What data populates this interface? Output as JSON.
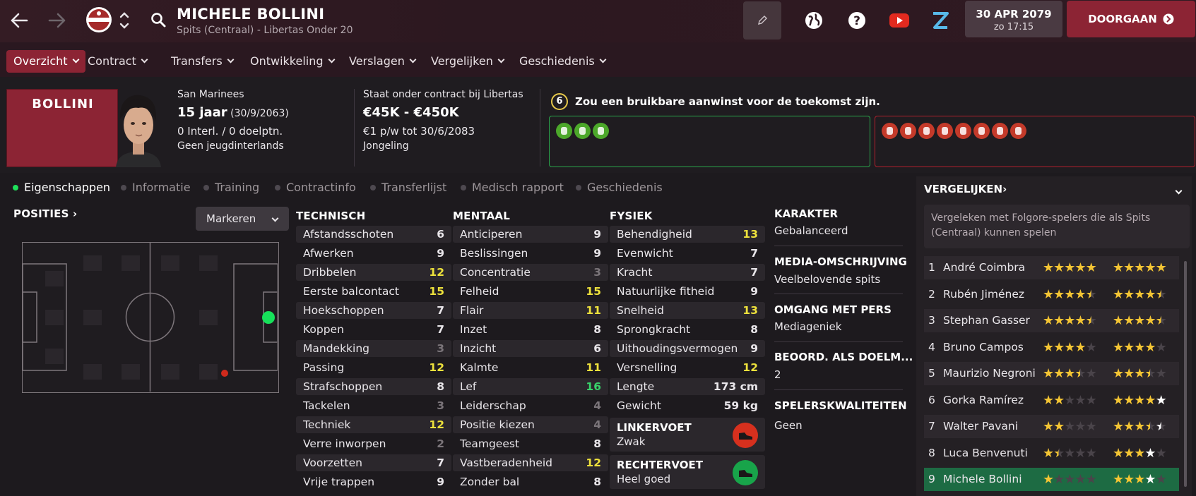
{
  "header": {
    "player_name": "MICHELE BOLLINI",
    "subtitle": "Spits (Centraal) - Libertas Onder 20",
    "date": "30 APR 2079",
    "time": "zo 17:15",
    "continue_label": "DOORGAAN"
  },
  "nav": {
    "items": [
      "Overzicht",
      "Contract",
      "Transfers",
      "Ontwikkeling",
      "Verslagen",
      "Vergelijken",
      "Geschiedenis"
    ]
  },
  "profile": {
    "card_name": "BOLLINI",
    "nationality": "San Marinees",
    "age": "15 jaar",
    "dob": "(30/9/2063)",
    "caps": "0 Interl. / 0 doelptn.",
    "youth_caps": "Geen jeugdinterlands",
    "contract_status": "Staat onder contract bij Libertas",
    "value": "€45K - €450K",
    "wage": "€1 p/w tot 30/6/2083",
    "contract_type": "Jongeling",
    "scout_rating": "6",
    "scout_text": "Zou een bruikbare aanwinst voor de toekomst zijn."
  },
  "tabs": [
    "Eigenschappen",
    "Informatie",
    "Training",
    "Contractinfo",
    "Transferlijst",
    "Medisch rapport",
    "Geschiedenis"
  ],
  "positions": {
    "title": "POSITIES",
    "mark_label": "Markeren"
  },
  "technical": {
    "title": "TECHNISCH",
    "rows": [
      {
        "label": "Afstandsschoten",
        "value": "6",
        "c": "w"
      },
      {
        "label": "Afwerken",
        "value": "9",
        "c": "w"
      },
      {
        "label": "Dribbelen",
        "value": "12",
        "c": "y"
      },
      {
        "label": "Eerste balcontact",
        "value": "15",
        "c": "y"
      },
      {
        "label": "Hoekschoppen",
        "value": "7",
        "c": "w"
      },
      {
        "label": "Koppen",
        "value": "7",
        "c": "w"
      },
      {
        "label": "Mandekking",
        "value": "3",
        "c": "gr"
      },
      {
        "label": "Passing",
        "value": "12",
        "c": "y"
      },
      {
        "label": "Strafschoppen",
        "value": "8",
        "c": "w"
      },
      {
        "label": "Tackelen",
        "value": "3",
        "c": "gr"
      },
      {
        "label": "Techniek",
        "value": "12",
        "c": "y"
      },
      {
        "label": "Verre inworpen",
        "value": "2",
        "c": "gr"
      },
      {
        "label": "Voorzetten",
        "value": "7",
        "c": "w"
      },
      {
        "label": "Vrije trappen",
        "value": "9",
        "c": "w"
      }
    ]
  },
  "mental": {
    "title": "MENTAAL",
    "rows": [
      {
        "label": "Anticiperen",
        "value": "9",
        "c": "w"
      },
      {
        "label": "Beslissingen",
        "value": "9",
        "c": "w"
      },
      {
        "label": "Concentratie",
        "value": "3",
        "c": "gr"
      },
      {
        "label": "Felheid",
        "value": "15",
        "c": "y"
      },
      {
        "label": "Flair",
        "value": "11",
        "c": "y"
      },
      {
        "label": "Inzet",
        "value": "8",
        "c": "w"
      },
      {
        "label": "Inzicht",
        "value": "6",
        "c": "w"
      },
      {
        "label": "Kalmte",
        "value": "11",
        "c": "y"
      },
      {
        "label": "Lef",
        "value": "16",
        "c": "g"
      },
      {
        "label": "Leiderschap",
        "value": "4",
        "c": "gr"
      },
      {
        "label": "Positie kiezen",
        "value": "4",
        "c": "gr"
      },
      {
        "label": "Teamgeest",
        "value": "8",
        "c": "w"
      },
      {
        "label": "Vastberadenheid",
        "value": "12",
        "c": "y"
      },
      {
        "label": "Zonder bal",
        "value": "8",
        "c": "w"
      }
    ]
  },
  "physical": {
    "title": "FYSIEK",
    "rows": [
      {
        "label": "Behendigheid",
        "value": "13",
        "c": "y"
      },
      {
        "label": "Evenwicht",
        "value": "7",
        "c": "w"
      },
      {
        "label": "Kracht",
        "value": "7",
        "c": "w"
      },
      {
        "label": "Natuurlijke fitheid",
        "value": "9",
        "c": "w"
      },
      {
        "label": "Snelheid",
        "value": "13",
        "c": "y"
      },
      {
        "label": "Sprongkracht",
        "value": "8",
        "c": "w"
      },
      {
        "label": "Uithoudingsvermogen",
        "value": "9",
        "c": "w"
      },
      {
        "label": "Versnelling",
        "value": "12",
        "c": "y"
      },
      {
        "label": "Lengte",
        "value": "173 cm",
        "c": "w"
      },
      {
        "label": "Gewicht",
        "value": "59 kg",
        "c": "w"
      }
    ],
    "left_foot_label": "LINKERVOET",
    "left_foot_value": "Zwak",
    "right_foot_label": "RECHTERVOET",
    "right_foot_value": "Heel goed"
  },
  "side": {
    "character_label": "KARAKTER",
    "character_value": "Gebalanceerd",
    "media_label": "MEDIA-OMSCHRIJVING",
    "media_value": "Veelbelovende spits",
    "press_label": "OMGANG MET PERS",
    "press_value": "Mediageniek",
    "gk_label": "BEOORD. ALS DOELM...",
    "gk_value": "2",
    "quality_label": "SPELERSKWALITEITEN",
    "quality_value": "Geen"
  },
  "compare": {
    "title": "VERGELIJKEN",
    "description": "Vergeleken met Folgore-spelers die als Spits (Centraal) kunnen spelen",
    "rows": [
      {
        "rank": "1",
        "name": "André Coimbra",
        "cur": 5,
        "pot": 5
      },
      {
        "rank": "2",
        "name": "Rubén Jiménez",
        "cur": 4.5,
        "pot": 4.5
      },
      {
        "rank": "3",
        "name": "Stephan Gasser",
        "cur": 4.5,
        "pot": 4.5
      },
      {
        "rank": "4",
        "name": "Bruno Campos",
        "cur": 4,
        "pot": 4
      },
      {
        "rank": "5",
        "name": "Maurizio Negroni",
        "cur": 3.5,
        "pot": 3.5
      },
      {
        "rank": "6",
        "name": "Gorka Ramírez",
        "cur": 2,
        "pot": 4,
        "potw": 1
      },
      {
        "rank": "7",
        "name": "Walter Pavani",
        "cur": 2,
        "pot": 3.5,
        "potw": 0.5
      },
      {
        "rank": "8",
        "name": "Luca Benvenuti",
        "cur": 1.5,
        "pot": 3,
        "potw": 1
      },
      {
        "rank": "9",
        "name": "Michele Bollini",
        "cur": 1,
        "pot": 3,
        "potw": 1
      }
    ]
  },
  "colors": {
    "accent": "#8c2434",
    "good": "#2aa64b",
    "bad": "#b2202c",
    "highlight": "#ede13c",
    "excellent": "#38d36a"
  }
}
